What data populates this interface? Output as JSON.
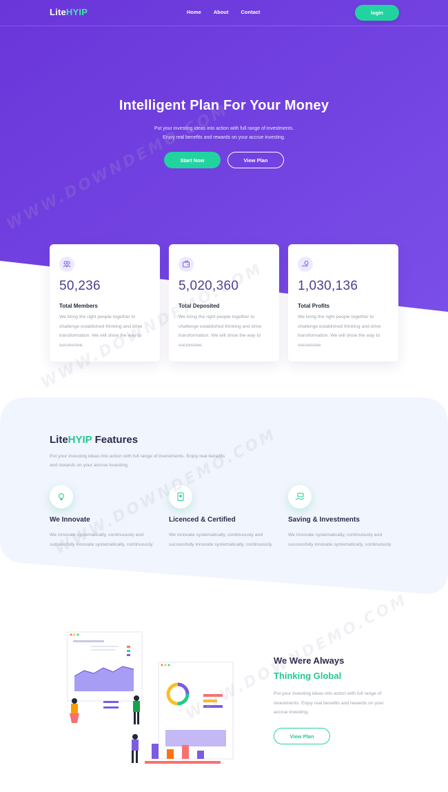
{
  "header": {
    "logo_prefix": "Lite",
    "logo_accent": "HYIP",
    "nav": [
      "Home",
      "About",
      "Contact"
    ],
    "login_label": "login"
  },
  "hero": {
    "title": "Intelligent Plan For Your Money",
    "subtitle_line1": "Put your investing ideas into action with full range of investments.",
    "subtitle_line2": "Enjoy real benefits and rewards on your accrue investing.",
    "start_label": "Start Now",
    "view_label": "View Plan"
  },
  "stats": [
    {
      "value": "50,236",
      "title": "Total Members",
      "desc": "We bring the right people together to challenge established thinking and drive transformation. We will show the way to successive.",
      "icon": "users-icon"
    },
    {
      "value": "5,020,360",
      "title": "Total Deposited",
      "desc": "We bring the right people together to challenge established thinking and drive transformation. We will show the way to successive.",
      "icon": "wallet-icon"
    },
    {
      "value": "1,030,136",
      "title": "Total Profits",
      "desc": "We bring the right people together to challenge established thinking and drive transformation. We will show the way to successive.",
      "icon": "hand-coin-icon"
    }
  ],
  "features": {
    "title_prefix": "Lite",
    "title_accent": "HYIP",
    "title_suffix": " Features",
    "subtitle": "Put your investing ideas into action with full range of investments. Enjoy real benefits and rewards on your accrue investing.",
    "items": [
      {
        "title": "We Innovate",
        "desc": "We innovate systematically, continuously and successfully innovate systematically, continuously",
        "icon": "lightbulb-icon"
      },
      {
        "title": "Licenced & Certified",
        "desc": "We innovate systematically, continuously and successfully innovate systematically, continuously",
        "icon": "certificate-icon"
      },
      {
        "title": "Saving & Investments",
        "desc": "We innovate systematically, continuously and successfully innovate systematically, continuously",
        "icon": "hand-money-icon"
      }
    ]
  },
  "global": {
    "title_line1": "We Were Always",
    "title_line2": "Thinking Global",
    "desc": "Put your investing ideas into action with full range of investments. Enjoy real benefits and rewards on your accrue investing.",
    "button_label": "View Plan"
  },
  "watermark": "WWW.DOWNDEMO.COM",
  "colors": {
    "primary_purple": "#6c3fe0",
    "accent_green": "#22d3a0",
    "text_dark": "#2a2a4a",
    "text_muted": "#9aa1ad"
  }
}
